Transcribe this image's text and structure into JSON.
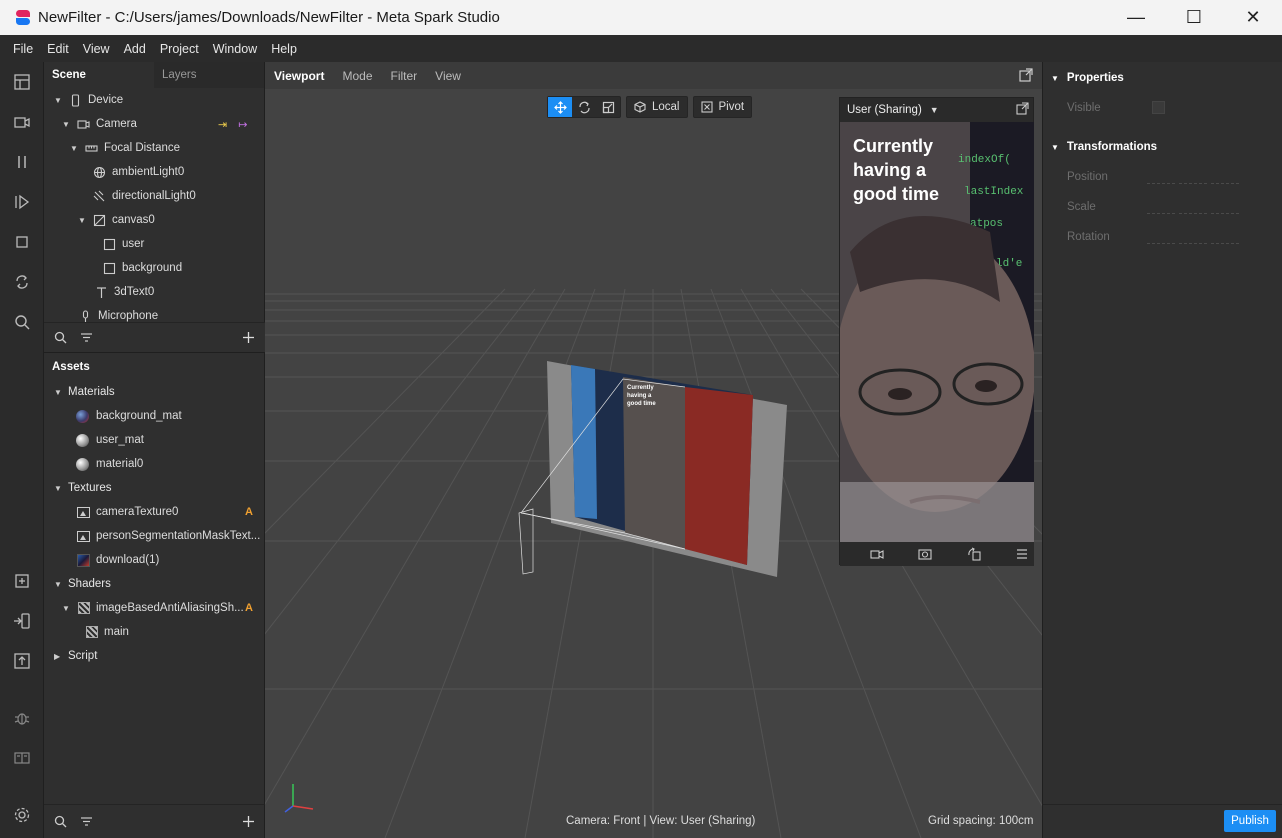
{
  "window": {
    "title": "NewFilter - C:/Users/james/Downloads/NewFilter - Meta Spark Studio",
    "min_glyph": "—",
    "max_glyph": "☐",
    "close_glyph": "✕"
  },
  "menu": [
    "File",
    "Edit",
    "View",
    "Add",
    "Project",
    "Window",
    "Help"
  ],
  "scene": {
    "tabs": [
      "Scene",
      "Layers"
    ],
    "tree": [
      {
        "label": "Device",
        "icon": "device-icon"
      },
      {
        "label": "Camera",
        "icon": "camera-icon"
      },
      {
        "label": "Focal Distance",
        "icon": "focal-distance-icon"
      },
      {
        "label": "ambientLight0",
        "icon": "ambient-light-icon"
      },
      {
        "label": "directionalLight0",
        "icon": "directional-light-icon"
      },
      {
        "label": "canvas0",
        "icon": "canvas-icon"
      },
      {
        "label": "user",
        "icon": "rectangle-icon"
      },
      {
        "label": "background",
        "icon": "rectangle-icon"
      },
      {
        "label": "3dText0",
        "icon": "text-icon"
      },
      {
        "label": "Microphone",
        "icon": "microphone-icon"
      }
    ],
    "device_buttons": [
      "⇥",
      "↦"
    ]
  },
  "assets": {
    "title": "Assets",
    "groups": {
      "materials": "Materials",
      "textures": "Textures",
      "shaders": "Shaders",
      "script": "Script"
    },
    "materials": [
      "background_mat",
      "user_mat",
      "material0"
    ],
    "textures": [
      "cameraTexture0",
      "personSegmentationMaskText...",
      "download(1)"
    ],
    "shaders": [
      "imageBasedAntiAliasingSh...",
      "main"
    ],
    "badge": "A"
  },
  "viewport": {
    "tabs": [
      "Viewport",
      "Mode",
      "Filter",
      "View"
    ],
    "local_label": "Local",
    "pivot_label": "Pivot",
    "status_camera": "Camera: Front | View: User (Sharing)",
    "grid_spacing": "Grid spacing: 100cm"
  },
  "preview": {
    "device": "User (Sharing)",
    "overlay_lines": [
      "Currently",
      "having a",
      "good time"
    ]
  },
  "properties": {
    "title": "Properties",
    "visible_label": "Visible",
    "transformations_title": "Transformations",
    "fields": [
      "Position",
      "Scale",
      "Rotation"
    ]
  },
  "publish_label": "Publish",
  "colors": {
    "accent": "#1c8ef4",
    "badge": "#f0a030",
    "device_buttons": "#e8c84a"
  }
}
